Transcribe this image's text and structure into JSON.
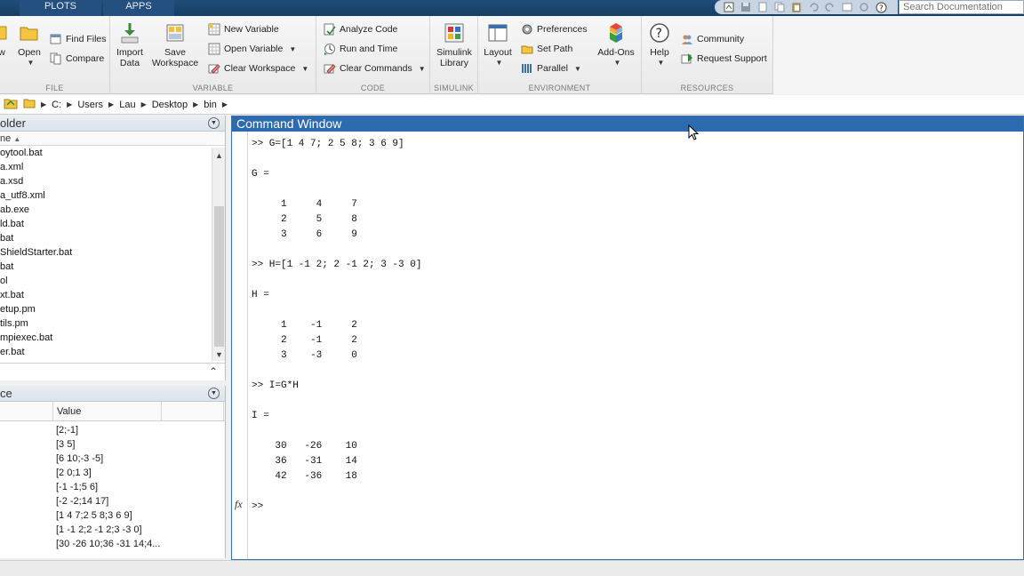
{
  "top_tabs": [
    "PLOTS",
    "APPS"
  ],
  "search": {
    "placeholder": "Search Documentation"
  },
  "ribbon": {
    "file": {
      "label": "FILE",
      "new_partial": "w",
      "open": "Open",
      "find_files": "Find Files",
      "compare": "Compare"
    },
    "variable": {
      "label": "VARIABLE",
      "import_line1": "Import",
      "import_line2": "Data",
      "save_line1": "Save",
      "save_line2": "Workspace",
      "new_variable": "New Variable",
      "open_variable": "Open Variable",
      "clear_workspace": "Clear Workspace"
    },
    "code": {
      "label": "CODE",
      "analyze_code": "Analyze Code",
      "run_and_time": "Run and Time",
      "clear_commands": "Clear Commands"
    },
    "simulink": {
      "label": "SIMULINK",
      "library_line1": "Simulink",
      "library_line2": "Library"
    },
    "environment": {
      "label": "ENVIRONMENT",
      "layout": "Layout",
      "preferences": "Preferences",
      "set_path": "Set Path",
      "parallel": "Parallel",
      "addons": "Add-Ons"
    },
    "resources": {
      "label": "RESOURCES",
      "help": "Help",
      "community": "Community",
      "request_support": "Request Support"
    }
  },
  "path": [
    "C:",
    "Users",
    "Lau",
    "Desktop",
    "bin"
  ],
  "current_folder": {
    "title_partial": "older",
    "name_header_partial": "ne",
    "files": [
      "oytool.bat",
      "a.xml",
      "a.xsd",
      "a_utf8.xml",
      "ab.exe",
      "ld.bat",
      "bat",
      "ShieldStarter.bat",
      "bat",
      "ol",
      "xt.bat",
      "etup.pm",
      "tils.pm",
      "mpiexec.bat",
      "er.bat"
    ]
  },
  "workspace": {
    "title_partial": "ce",
    "value_header": "Value",
    "values": [
      "[2;-1]",
      "[3 5]",
      "[6 10;-3 -5]",
      "[2 0;1 3]",
      "[-1 -1;5 6]",
      "[-2 -2;14 17]",
      "[1 4 7;2 5 8;3 6 9]",
      "[1 -1 2;2 -1 2;3 -3 0]",
      "[30 -26 10;36 -31 14;4..."
    ]
  },
  "command_window": {
    "title": "Command Window",
    "lines": [
      ">> G=[1 4 7; 2 5 8; 3 6 9]",
      "G =",
      "     1     4     7",
      "     2     5     8",
      "     3     6     9",
      ">> H=[1 -1 2; 2 -1 2; 3 -3 0]",
      "H =",
      "     1    -1     2",
      "     2    -1     2",
      "     3    -3     0",
      ">> I=G*H",
      "I =",
      "    30   -26    10",
      "    36   -31    14",
      "    42   -36    18",
      ">>"
    ],
    "fx": "fx"
  }
}
